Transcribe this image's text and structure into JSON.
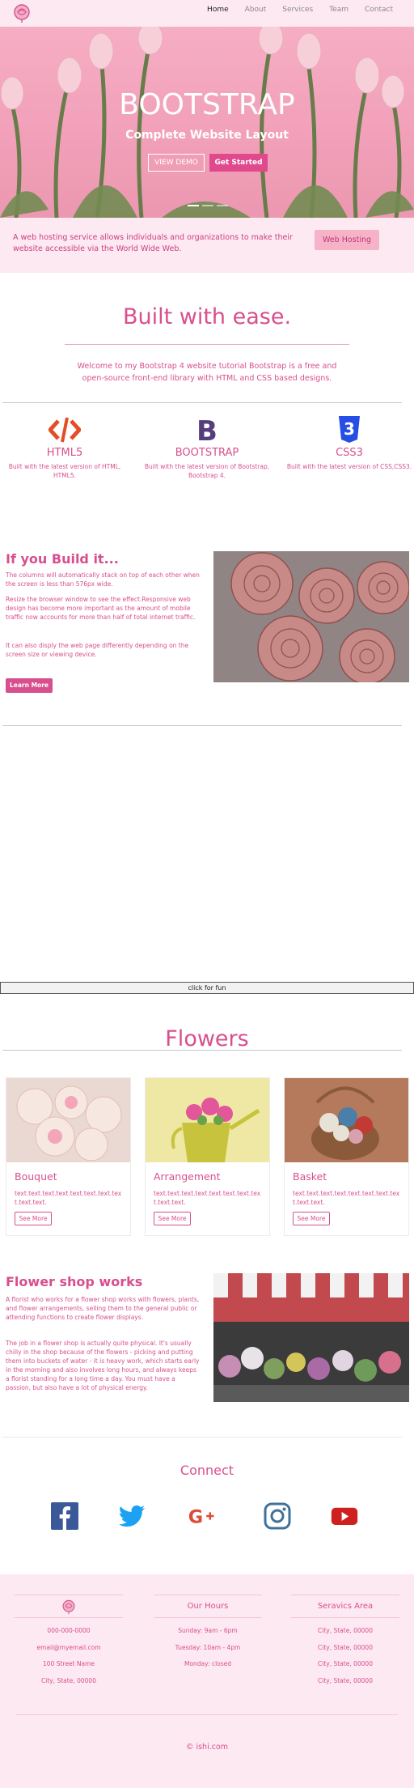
{
  "nav": {
    "logo": "rose-logo-icon",
    "items": [
      {
        "label": "Home",
        "active": true
      },
      {
        "label": "About"
      },
      {
        "label": "Services"
      },
      {
        "label": "Team"
      },
      {
        "label": "Contact"
      }
    ]
  },
  "hero": {
    "title": "BOOTSTRAP",
    "subtitle": "Complete Website Layout",
    "demo_label": "VIEW DEMO",
    "start_label": "Get Started",
    "slides": 3,
    "active_slide": 1
  },
  "jumbo": {
    "text": "A web hosting service allows individuals and organizations to make their website accessible via the World Wide Web.",
    "button": "Web Hosting"
  },
  "welcome": {
    "title": "Built with ease.",
    "text": "Welcome to my Bootstrap 4 website tutorial Bootstrap is a free and open-source front-end library with HTML and CSS based designs."
  },
  "features": [
    {
      "icon": "html5-icon",
      "title": "HTML5",
      "text": "Built with the latest version of HTML, HTML5."
    },
    {
      "icon": "bootstrap-icon",
      "title": "BOOTSTRAP",
      "text": "Built with the latest version of Bootstrap, Bootstrap 4."
    },
    {
      "icon": "css3-icon",
      "title": "CSS3",
      "text": "Built with the latest version of CSS,CSS3."
    }
  ],
  "build": {
    "title": "If you Build it...",
    "p1": "The columns will automatically stack on top of each other when the screen is less than 576px wide.",
    "p2": "Resize the browser window to see the effect.Responsive web design has become more important as the amount of mobile traffic now accounts for more than half of total internet traffic.",
    "p3": "It can also disply the web page differently depending on the screen size or viewing device.",
    "button": "Learn More"
  },
  "fun_label": "click for fun",
  "flowers": {
    "title": "Flowers",
    "cards": [
      {
        "title": "Bouquet",
        "text": "text.text.text.text.text.text.text.text.text.text.",
        "button": "See More"
      },
      {
        "title": "Arrangement",
        "text": "text.text.text.text.text.text.text.text.text.text.",
        "button": "See More"
      },
      {
        "title": "Basket",
        "text": "text.text.text.text.text.text.text.text.text.text.",
        "button": "See More"
      }
    ]
  },
  "shop": {
    "title": "Flower shop works",
    "p1": "A florist who works for a flower shop works with flowers, plants, and flower arrangements, selling them to the general public or attending functions to create flower displays.",
    "p2": "The job in a flower shop is actually quite physical. It's usually chilly in the shop because of the flowers - picking and putting them into buckets of water - it is heavy work, which starts early in the morning and also involves long hours, and always keeps a florist standing for a long time a day. You must have a passion, but also have a lot of physical energy."
  },
  "connect": {
    "title": "Connect",
    "icons": [
      "facebook-icon",
      "twitter-icon",
      "google-plus-icon",
      "instagram-icon",
      "youtube-icon"
    ]
  },
  "footer": {
    "col1": [
      "000-000-0000",
      "email@myemail.com",
      "100 Street Name",
      "City, State, 00000"
    ],
    "col2_title": "Our Hours",
    "col2": [
      "Sunday: 9am - 6pm",
      "Tuesday: 10am - 4pm",
      "Monday: closed"
    ],
    "col3_title": "Seravics Area",
    "col3": [
      "City, State, 00000",
      "City, State, 00000",
      "City, State, 00000",
      "City, State, 00000"
    ],
    "copyright": "© ishi.com"
  },
  "colors": {
    "accent": "#d84f8e",
    "pink_bg": "#fde9f1",
    "button_pink": "#e04a8d"
  }
}
